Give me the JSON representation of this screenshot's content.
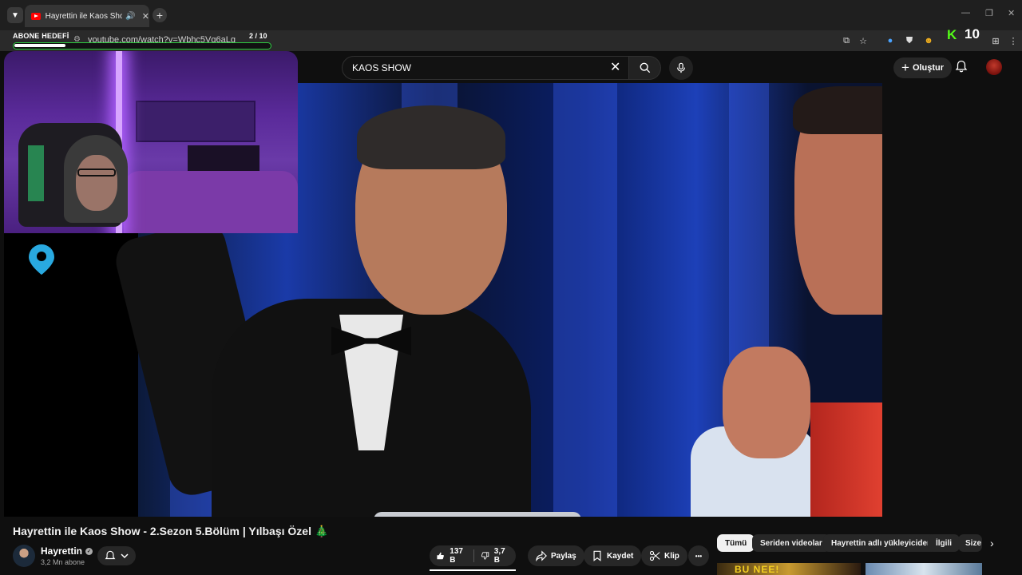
{
  "browser": {
    "tab_title": "Hayrettin ile Kaos Show - 2.",
    "url": "youtube.com/watch?v=Wbhc5Vq6aLg"
  },
  "overlay": {
    "goal_label": "ABONE HEDEFİ",
    "goal_count": "2 / 10",
    "goal_progress": 0.2,
    "kick_count": "10"
  },
  "youtube": {
    "search_value": "KAOS SHOW",
    "create_label": "Oluştur"
  },
  "video": {
    "title": "Hayrettin ile Kaos Show - 2.Sezon 5.Bölüm | Yılbaşı Özel",
    "title_emoji": "🎄",
    "channel_name": "Hayrettin",
    "subscribers": "3,2 Mn abone",
    "likes": "137 B",
    "dislikes": "3,7 B",
    "share_label": "Paylaş",
    "save_label": "Kaydet",
    "clip_label": "Klip",
    "more_label": "•••"
  },
  "chips": [
    "Tümü",
    "Seriden videolar",
    "Hayrettin adlı yükleyiciden",
    "İlgili",
    "Size"
  ],
  "recommendations": {
    "thumb1_text": "BU NEE!"
  }
}
